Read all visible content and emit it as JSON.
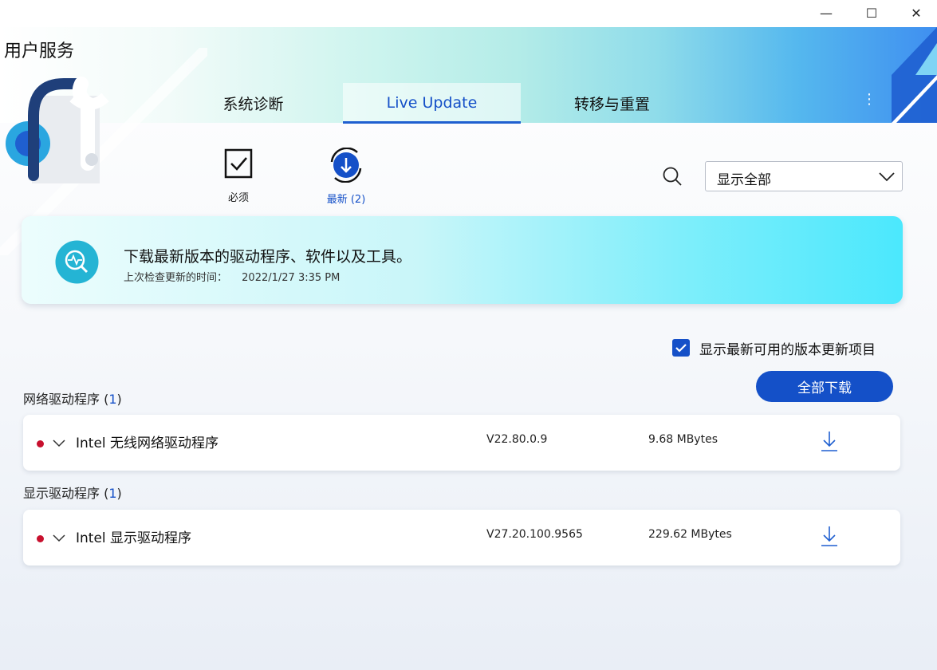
{
  "window": {
    "controls": {
      "minimize": "—",
      "maximize": "☐",
      "close": "✕"
    }
  },
  "app": {
    "title": "用户服务"
  },
  "tabs": [
    {
      "label": "系统诊断",
      "active": false
    },
    {
      "label": "Live Update",
      "active": true
    },
    {
      "label": "转移与重置",
      "active": false
    }
  ],
  "more_menu_glyph": "⋮",
  "filters": {
    "required": {
      "label": "必须",
      "icon": "checkbox-icon"
    },
    "latest": {
      "label": "最新 (2)",
      "icon": "refresh-download-icon"
    }
  },
  "search": {
    "icon": "search-icon"
  },
  "dropdown": {
    "selected": "显示全部"
  },
  "banner": {
    "title": "下载最新版本的驱动程序、软件以及工具。",
    "last_check_label": "上次检查更新的时间：",
    "last_check_value": "2022/1/27  3:35 PM"
  },
  "show_latest": {
    "checked": true,
    "label": "显示最新可用的版本更新项目"
  },
  "download_all": "全部下载",
  "sections": [
    {
      "title": "网络驱动程序",
      "count": "1",
      "items": [
        {
          "name": "Intel 无线网络驱动程序",
          "version": "V22.80.0.9",
          "size": "9.68 MBytes"
        }
      ]
    },
    {
      "title": "显示驱动程序",
      "count": "1",
      "items": [
        {
          "name": "Intel 显示驱动程序",
          "version": "V27.20.100.9565",
          "size": "229.62 MBytes"
        }
      ]
    }
  ],
  "colors": {
    "accent": "#1550c8",
    "status_dot": "#c8102e",
    "banner_end": "#4be8fd"
  }
}
